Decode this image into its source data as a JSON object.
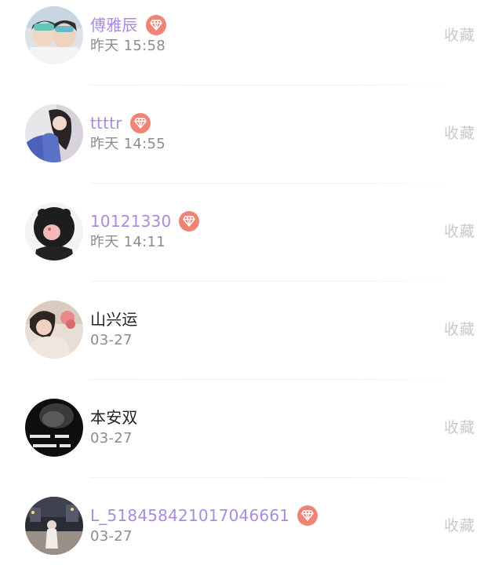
{
  "collect_label": "收藏",
  "colors": {
    "vip_name": "#a98be0",
    "plain_name": "#222222",
    "time": "#8c8c8c",
    "collect": "#c9c9c9",
    "vip_badge": "#ee8476"
  },
  "users": [
    {
      "name": "傅雅辰",
      "time": "昨天 15:58",
      "vip": true,
      "avatar": "avatar-two-girls-photo"
    },
    {
      "name": "ttttr",
      "time": "昨天 14:55",
      "vip": true,
      "avatar": "avatar-girl-in-blue-photo"
    },
    {
      "name": "10121330",
      "time": "昨天 14:11",
      "vip": true,
      "avatar": "avatar-cartoon-blob-photo"
    },
    {
      "name": "山兴运",
      "time": "03-27",
      "vip": false,
      "avatar": "avatar-woman-with-flower-photo"
    },
    {
      "name": "本安双",
      "time": "03-27",
      "vip": false,
      "avatar": "avatar-dark-text-photo"
    },
    {
      "name": "L_518458421017046661",
      "time": "03-27",
      "vip": true,
      "avatar": "avatar-street-night-photo"
    }
  ]
}
